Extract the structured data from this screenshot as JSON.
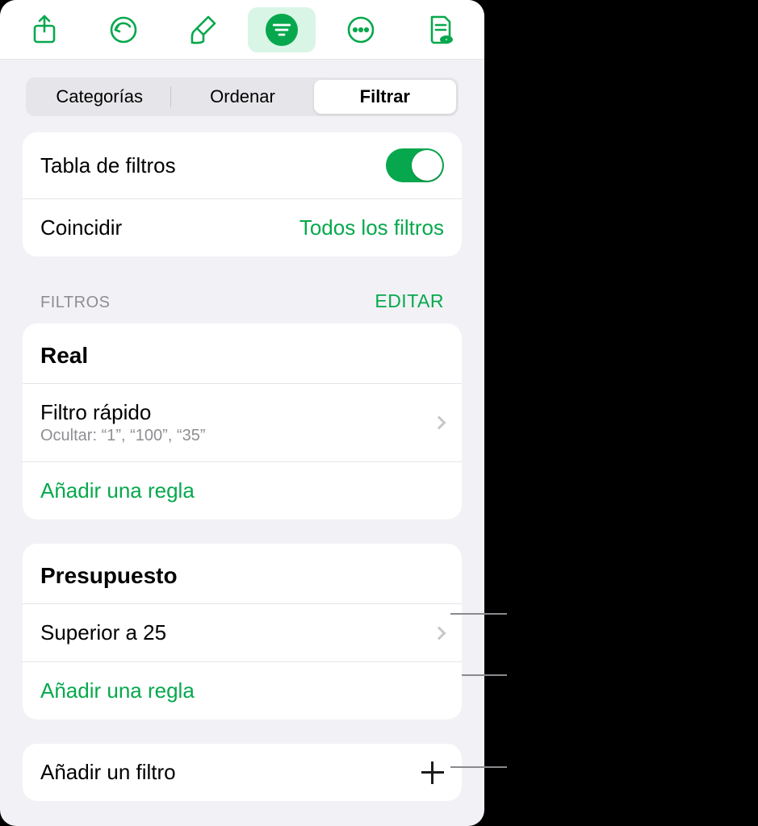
{
  "colors": {
    "accent": "#07a84d"
  },
  "segmented": {
    "categories": "Categorías",
    "sort": "Ordenar",
    "filter": "Filtrar"
  },
  "topCard": {
    "filter_table_label": "Tabla de filtros",
    "match_label": "Coincidir",
    "match_value": "Todos los filtros"
  },
  "section": {
    "title": "FILTROS",
    "edit": "EDITAR"
  },
  "group1": {
    "title": "Real",
    "quick_label": "Filtro rápido",
    "quick_sub": "Ocultar: “1”, “100”, “35”",
    "add_rule": "Añadir una regla"
  },
  "group2": {
    "title": "Presupuesto",
    "rule_label": "Superior a 25",
    "add_rule": "Añadir una regla"
  },
  "addFilter": {
    "label": "Añadir un filtro"
  }
}
